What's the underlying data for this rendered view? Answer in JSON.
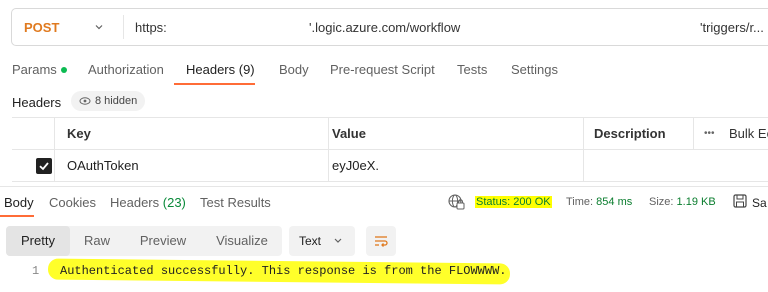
{
  "request": {
    "method": "POST",
    "url_parts": [
      "https:",
      "'.logic.azure.com/workflow",
      "'triggers/r..."
    ]
  },
  "request_tabs": [
    {
      "label": "Params",
      "dot": true
    },
    {
      "label": "Authorization"
    },
    {
      "label": "Headers (9)"
    },
    {
      "label": "Body"
    },
    {
      "label": "Pre-request Script"
    },
    {
      "label": "Tests"
    },
    {
      "label": "Settings"
    }
  ],
  "headers_section": {
    "label": "Headers",
    "hidden_count": "8 hidden"
  },
  "table": {
    "columns": [
      "Key",
      "Value",
      "Description",
      "Bulk Ec"
    ],
    "more_label": "•••",
    "rows": [
      {
        "key": "OAuthToken",
        "value": "eyJ0eX.",
        "description": ""
      }
    ]
  },
  "response_tabs": [
    {
      "label": "Body"
    },
    {
      "label": "Cookies"
    },
    {
      "label": "Headers",
      "count": "(23)"
    },
    {
      "label": "Test Results"
    }
  ],
  "response_meta": {
    "status": "Status: 200 OK",
    "time_label": "Time:",
    "time_value": "854 ms",
    "size_label": "Size:",
    "size_value": "1.19 KB",
    "save_label": "Sa"
  },
  "format_buttons": [
    "Pretty",
    "Raw",
    "Preview",
    "Visualize"
  ],
  "text_select": "Text",
  "code": {
    "line_no": "1",
    "text": "Authenticated successfully. This response is from the FLOWWWW."
  },
  "colors": {
    "accent": "#ff6c37",
    "method": "#e07a1f",
    "success": "#0a7d2e",
    "highlight": "#ffff00"
  }
}
